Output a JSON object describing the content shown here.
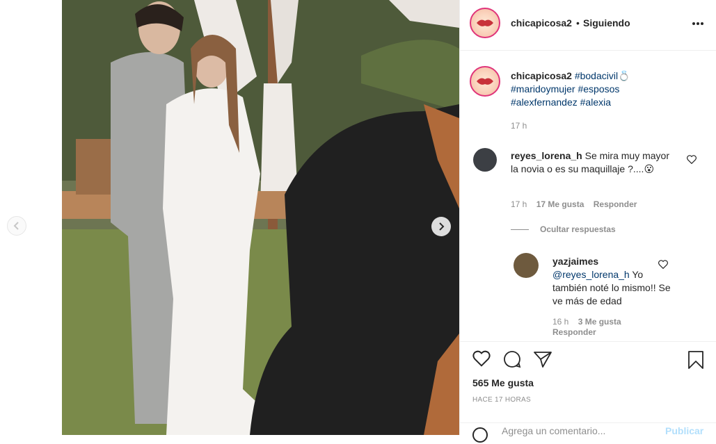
{
  "post": {
    "username": "chicapicosa2",
    "separator": "•",
    "follow_status": "Siguiendo",
    "more_icon": "more-options-icon",
    "caption": {
      "username": "chicapicosa2",
      "tags_line1": "#bodacivil💍",
      "tags_line2": [
        "#maridoymujer",
        "#esposos"
      ],
      "tags_line3": [
        "#alexfernandez",
        "#alexia"
      ],
      "time": "17 h"
    },
    "comments": [
      {
        "username": "reyes_lorena_h",
        "text": "Se mira muy mayor la novia o es su maquillaje ?....😮",
        "time": "17 h",
        "likes": "17 Me gusta",
        "reply_label": "Responder",
        "hide_replies": "Ocultar respuestas",
        "replies": [
          {
            "username": "yazjaimes",
            "mention": "@reyes_lorena_h",
            "text": "Yo también noté lo mismo!! Se ve más de edad",
            "time": "16 h",
            "likes": "3 Me gusta",
            "reply_label": "Responder"
          }
        ]
      }
    ],
    "likes_count": "565 Me gusta",
    "posted_ago": "HACE 17 HORAS",
    "add_comment_placeholder": "Agrega un comentario...",
    "publish_label": "Publicar"
  },
  "carousel": {
    "prev_icon": "chevron-left-icon",
    "next_icon": "chevron-right-icon"
  },
  "colors": {
    "link": "#00376b",
    "muted": "#8e8e8e",
    "story_ring": "#e0347a",
    "publish_disabled": "#b2dffc"
  }
}
